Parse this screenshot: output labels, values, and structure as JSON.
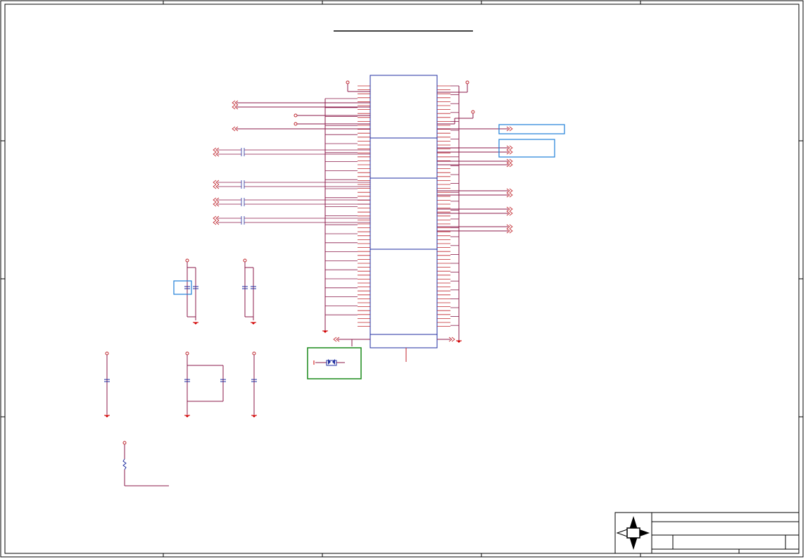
{
  "sheet": {
    "title": "",
    "zones": {
      "columns": [],
      "rows": []
    }
  },
  "colors": {
    "frame": "#000000",
    "wire": "#8b1a4a",
    "pin": "#c0262d",
    "component": "#1f2ea0",
    "power": "#d20000",
    "highlight_blue": "#1e7fd8",
    "highlight_green": "#1a8a1a"
  },
  "icons": {
    "logo": "compass-arrows-logo",
    "ground": "ground-symbol-icon",
    "capacitor": "capacitor-icon",
    "resistor": "resistor-icon",
    "crystal": "crystal-icon",
    "offsheet": "offsheet-connector-icon"
  },
  "title_block": {
    "title": "",
    "size": "",
    "number": "",
    "rev": "",
    "date": "",
    "sheet": ""
  }
}
